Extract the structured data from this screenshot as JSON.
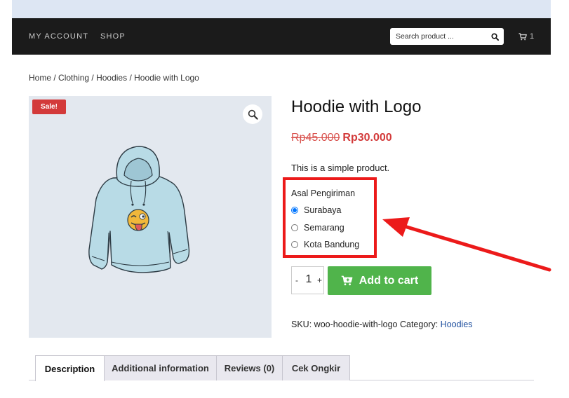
{
  "nav": {
    "items": [
      {
        "label": "MY ACCOUNT"
      },
      {
        "label": "SHOP"
      }
    ],
    "search_placeholder": "Search product ...",
    "cart_count": "1"
  },
  "breadcrumb": {
    "home": "Home",
    "sep": " / ",
    "clothing": "Clothing",
    "hoodies": "Hoodies",
    "current": "Hoodie with Logo"
  },
  "gallery": {
    "sale_badge": "Sale!"
  },
  "product": {
    "title": "Hoodie with Logo",
    "price_old": "Rp45.000",
    "price_new": "Rp30.000",
    "short_description": "This is a simple product."
  },
  "shipping": {
    "label": "Asal Pengiriman",
    "options": [
      {
        "label": "Surabaya",
        "checked": true
      },
      {
        "label": "Semarang",
        "checked": false
      },
      {
        "label": "Kota Bandung",
        "checked": false
      }
    ]
  },
  "cart_form": {
    "minus": "-",
    "plus": "+",
    "quantity": "1",
    "add_to_cart_label": "Add to cart"
  },
  "meta": {
    "sku_label": "SKU:",
    "sku_value": "woo-hoodie-with-logo",
    "category_label": "Category:",
    "category_value": "Hoodies"
  },
  "tabs": [
    {
      "label": "Description",
      "active": true
    },
    {
      "label": "Additional information",
      "active": false
    },
    {
      "label": "Reviews (0)",
      "active": false
    },
    {
      "label": "Cek Ongkir",
      "active": false
    }
  ],
  "colors": {
    "nav_bg": "#1b1b1b",
    "top_band": "#dde6f3",
    "sale_red": "#d33a3a",
    "add_to_cart_green": "#50b44b",
    "annotation_red": "#ec1a1a",
    "link_blue": "#1e4f9e"
  }
}
